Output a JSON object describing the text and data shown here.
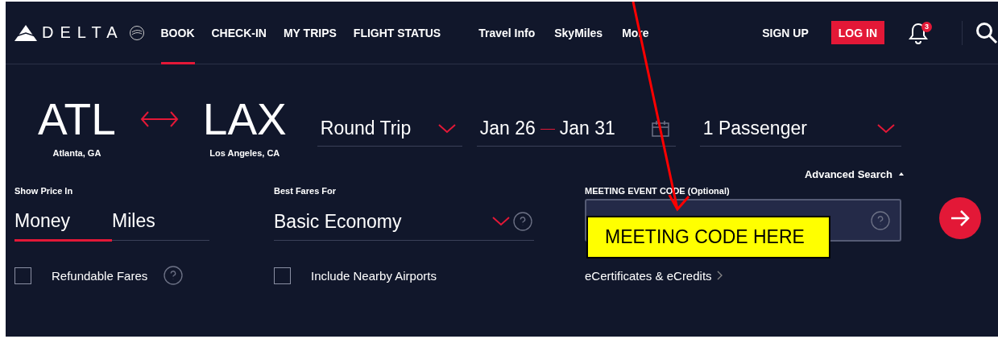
{
  "header": {
    "logo": "DELTA",
    "primary_nav": [
      {
        "label": "BOOK",
        "selected": true
      },
      {
        "label": "CHECK-IN",
        "selected": false
      },
      {
        "label": "MY TRIPS",
        "selected": false
      },
      {
        "label": "FLIGHT STATUS",
        "selected": false
      }
    ],
    "secondary_nav": [
      "Travel Info",
      "SkyMiles",
      "More"
    ],
    "sign_up": "SIGN UP",
    "log_in": "LOG IN",
    "notifications": "3"
  },
  "trip": {
    "origin": {
      "code": "ATL",
      "city": "Atlanta, GA"
    },
    "destination": {
      "code": "LAX",
      "city": "Los Angeles, CA"
    },
    "trip_type": "Round Trip",
    "depart": "Jan 26",
    "return": "Jan 31",
    "passengers": "1 Passenger"
  },
  "advanced_search": "Advanced Search",
  "price": {
    "label": "Show Price In",
    "options": [
      {
        "label": "Money",
        "selected": true
      },
      {
        "label": "Miles",
        "selected": false
      }
    ]
  },
  "fares": {
    "label": "Best Fares For",
    "value": "Basic Economy"
  },
  "meeting": {
    "label": "MEETING EVENT CODE (Optional)"
  },
  "options": [
    {
      "label": "Refundable Fares",
      "checked": false,
      "help": true
    },
    {
      "label": "Include Nearby Airports",
      "checked": false,
      "help": false
    }
  ],
  "ecredits": "eCertificates & eCredits",
  "annotation": {
    "callout": "MEETING CODE HERE"
  }
}
